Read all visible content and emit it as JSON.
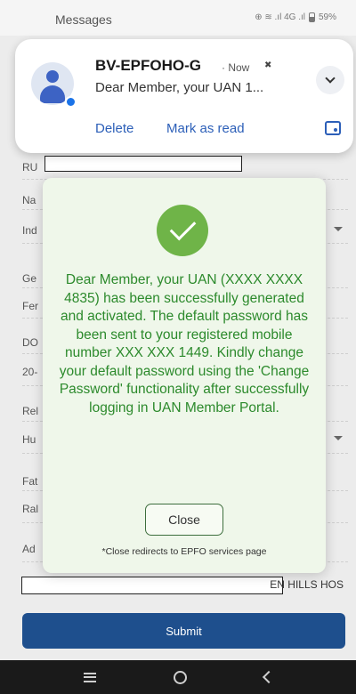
{
  "status_bar": {
    "app_name": "Messages",
    "icons_text": "⊕ ≋ .ıl 4G .ıl",
    "battery": "59%"
  },
  "notification": {
    "sender": "BV-EPFOHO-G",
    "time": "· Now",
    "preview": "Dear Member, your UAN 1...",
    "actions": [
      "Delete",
      "Mark as read"
    ],
    "icons": {
      "avatar": "person-avatar-icon",
      "expand": "chevron-down-icon",
      "otp": "copy-otp-icon",
      "silent": "bell-off-icon"
    }
  },
  "form": {
    "fields": [
      {
        "label": "RU"
      },
      {
        "label": "Na"
      },
      {
        "label": "Ind"
      },
      {
        "label": "Ge"
      },
      {
        "label": "Fer"
      },
      {
        "label": "DO"
      },
      {
        "label": "20-"
      },
      {
        "label": "Rel"
      },
      {
        "label": "Hu"
      },
      {
        "label": "Fat"
      },
      {
        "label": "Ral"
      },
      {
        "label": "Ad"
      }
    ],
    "address_tail": "EN HILLS HOS",
    "submit_label": "Submit"
  },
  "modal": {
    "message": "Dear Member, your UAN (XXXX XXXX 4835) has been successfully generated and activated. The default password has been sent to your registered mobile number XXX XXX 1449. Kindly change your default password using the 'Change Password' functionality after successfully logging in UAN Member Portal.",
    "close_label": "Close",
    "note": "*Close redirects to EPFO services page",
    "icon": "success-check-icon",
    "colors": {
      "success": "#6fb448",
      "text": "#2c8a2c"
    }
  },
  "nav": {
    "icons": [
      "recent-apps-icon",
      "home-icon",
      "back-icon"
    ]
  },
  "colors": {
    "submit": "#1e4f8d",
    "link": "#2c5fb8"
  }
}
